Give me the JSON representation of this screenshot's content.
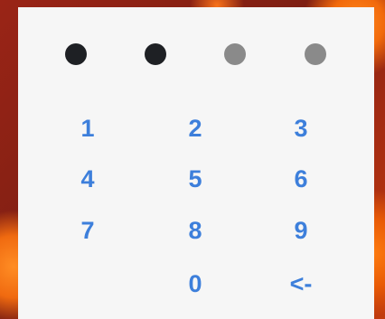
{
  "pin_indicator": {
    "dots": [
      {
        "state": "filled"
      },
      {
        "state": "filled"
      },
      {
        "state": "empty"
      },
      {
        "state": "empty"
      }
    ]
  },
  "keypad": {
    "key_1": "1",
    "key_2": "2",
    "key_3": "3",
    "key_4": "4",
    "key_5": "5",
    "key_6": "6",
    "key_7": "7",
    "key_8": "8",
    "key_9": "9",
    "key_0": "0",
    "backspace": "<-"
  },
  "colors": {
    "key_text": "#3d7fdb",
    "dot_filled": "#1e2024",
    "dot_empty": "#8a8a8a",
    "card_background": "#f6f6f6"
  }
}
